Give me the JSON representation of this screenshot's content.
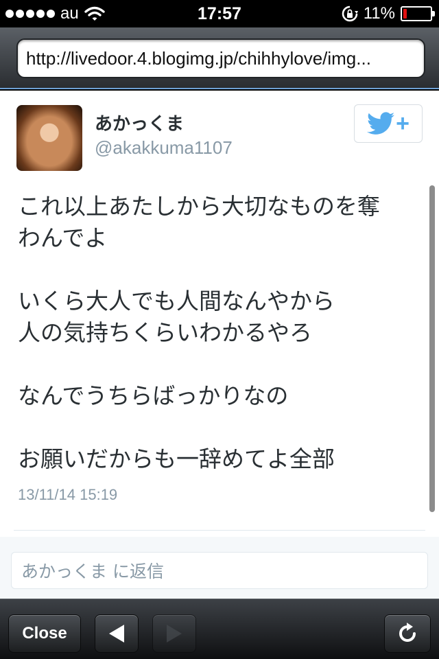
{
  "status_bar": {
    "carrier": "au",
    "time": "17:57",
    "battery_percent": "11%",
    "battery_level": 0.11,
    "signal_bars_filled": 5,
    "icons": [
      "signal-dots-icon",
      "wifi-icon",
      "rotation-lock-icon",
      "battery-icon"
    ]
  },
  "browser": {
    "url": "http://livedoor.4.blogimg.jp/chihhylove/img...",
    "toolbar": {
      "close_label": "Close",
      "back_icon": "back-arrow-icon",
      "forward_icon": "forward-arrow-icon",
      "reload_icon": "reload-icon"
    }
  },
  "tweet": {
    "user_name": "あかっくま",
    "user_handle": "@akakkuma1107",
    "text_lines": [
      "これ以上あたしから大切なものを奪",
      "わんでよ",
      "",
      "いくら大人でも人間なんやから",
      "人の気持ちくらいわかるやろ",
      "",
      "なんでうちらばっかりなの",
      "",
      "お願いだからも一辞めてよ全部"
    ],
    "timestamp": "13/11/14 15:19",
    "reply_placeholder": "あかっくま に返信"
  },
  "colors": {
    "twitter_blue": "#55acee",
    "text_primary": "#292f33",
    "text_secondary": "#8899a6",
    "battery_low": "#e01010"
  }
}
